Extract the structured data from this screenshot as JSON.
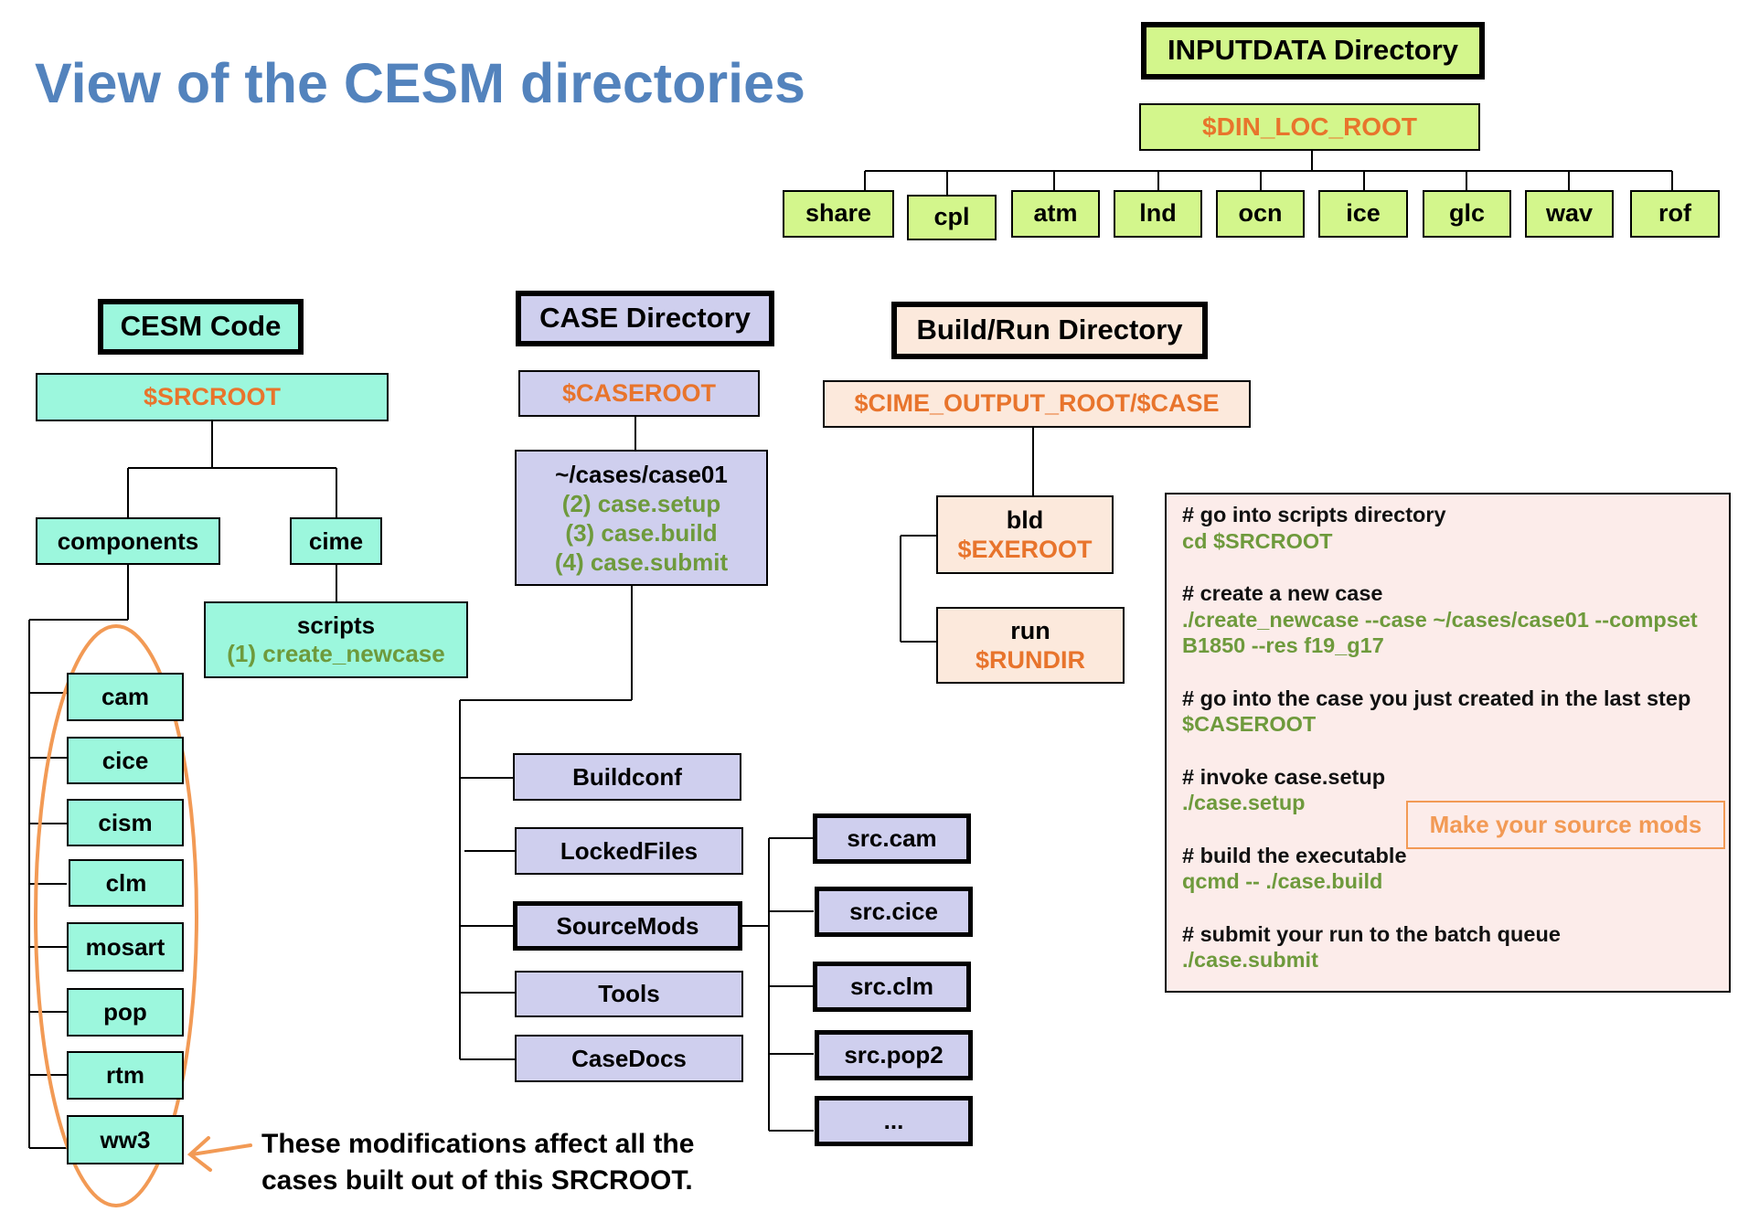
{
  "title": "View of the CESM directories",
  "colors": {
    "title": "#5383bd",
    "inputdata_fill": "#d3f68c",
    "code_fill": "#9cf7dd",
    "case_fill": "#cfcfee",
    "buildrun_fill": "#fce9dc",
    "variable_text": "#e8742c",
    "command_text": "#6e9a3c",
    "annotation": "#f29a55"
  },
  "inputdata": {
    "header": "INPUTDATA Directory",
    "root": "$DIN_LOC_ROOT",
    "children": [
      "share",
      "cpl",
      "atm",
      "lnd",
      "ocn",
      "ice",
      "glc",
      "wav",
      "rof"
    ]
  },
  "cesm_code": {
    "header": "CESM Code",
    "root": "$SRCROOT",
    "components": {
      "label": "components",
      "children": [
        "cam",
        "cice",
        "cism",
        "clm",
        "mosart",
        "pop",
        "rtm",
        "ww3"
      ]
    },
    "cime": {
      "label": "cime",
      "scripts": {
        "label": "scripts",
        "step": "(1) create_newcase"
      }
    },
    "note": {
      "line1": "These modifications affect all the",
      "line2": "cases built out of this SRCROOT."
    }
  },
  "case_dir": {
    "header": "CASE Directory",
    "root": "$CASEROOT",
    "case": {
      "path": "~/cases/case01",
      "steps": [
        "(2) case.setup",
        "(3) case.build",
        "(4) case.submit"
      ]
    },
    "subdirs": [
      "Buildconf",
      "LockedFiles",
      "SourceMods",
      "Tools",
      "CaseDocs"
    ],
    "sourcemods_children": [
      "src.cam",
      "src.cice",
      "src.clm",
      "src.pop2",
      "..."
    ]
  },
  "build_run": {
    "header": "Build/Run Directory",
    "root": "$CIME_OUTPUT_ROOT/$CASE",
    "bld": {
      "label": "bld",
      "var": "$EXEROOT"
    },
    "run": {
      "label": "run",
      "var": "$RUNDIR"
    }
  },
  "commands": [
    {
      "comment": "# go into scripts directory",
      "lines": [
        "cd $SRCROOT"
      ]
    },
    {
      "comment": "# create a new case",
      "lines": [
        "./create_newcase --case ~/cases/case01 --compset",
        "B1850 --res f19_g17"
      ]
    },
    {
      "comment": "# go into the case you just created in the last step",
      "lines": [
        "$CASEROOT"
      ]
    },
    {
      "comment": "# invoke case.setup",
      "lines": [
        "./case.setup"
      ]
    },
    {
      "comment": "# build the executable",
      "lines": [
        "qcmd -- ./case.build"
      ]
    },
    {
      "comment": "# submit your run to the batch queue",
      "lines": [
        "./case.submit"
      ]
    }
  ],
  "callout": "Make your source mods"
}
